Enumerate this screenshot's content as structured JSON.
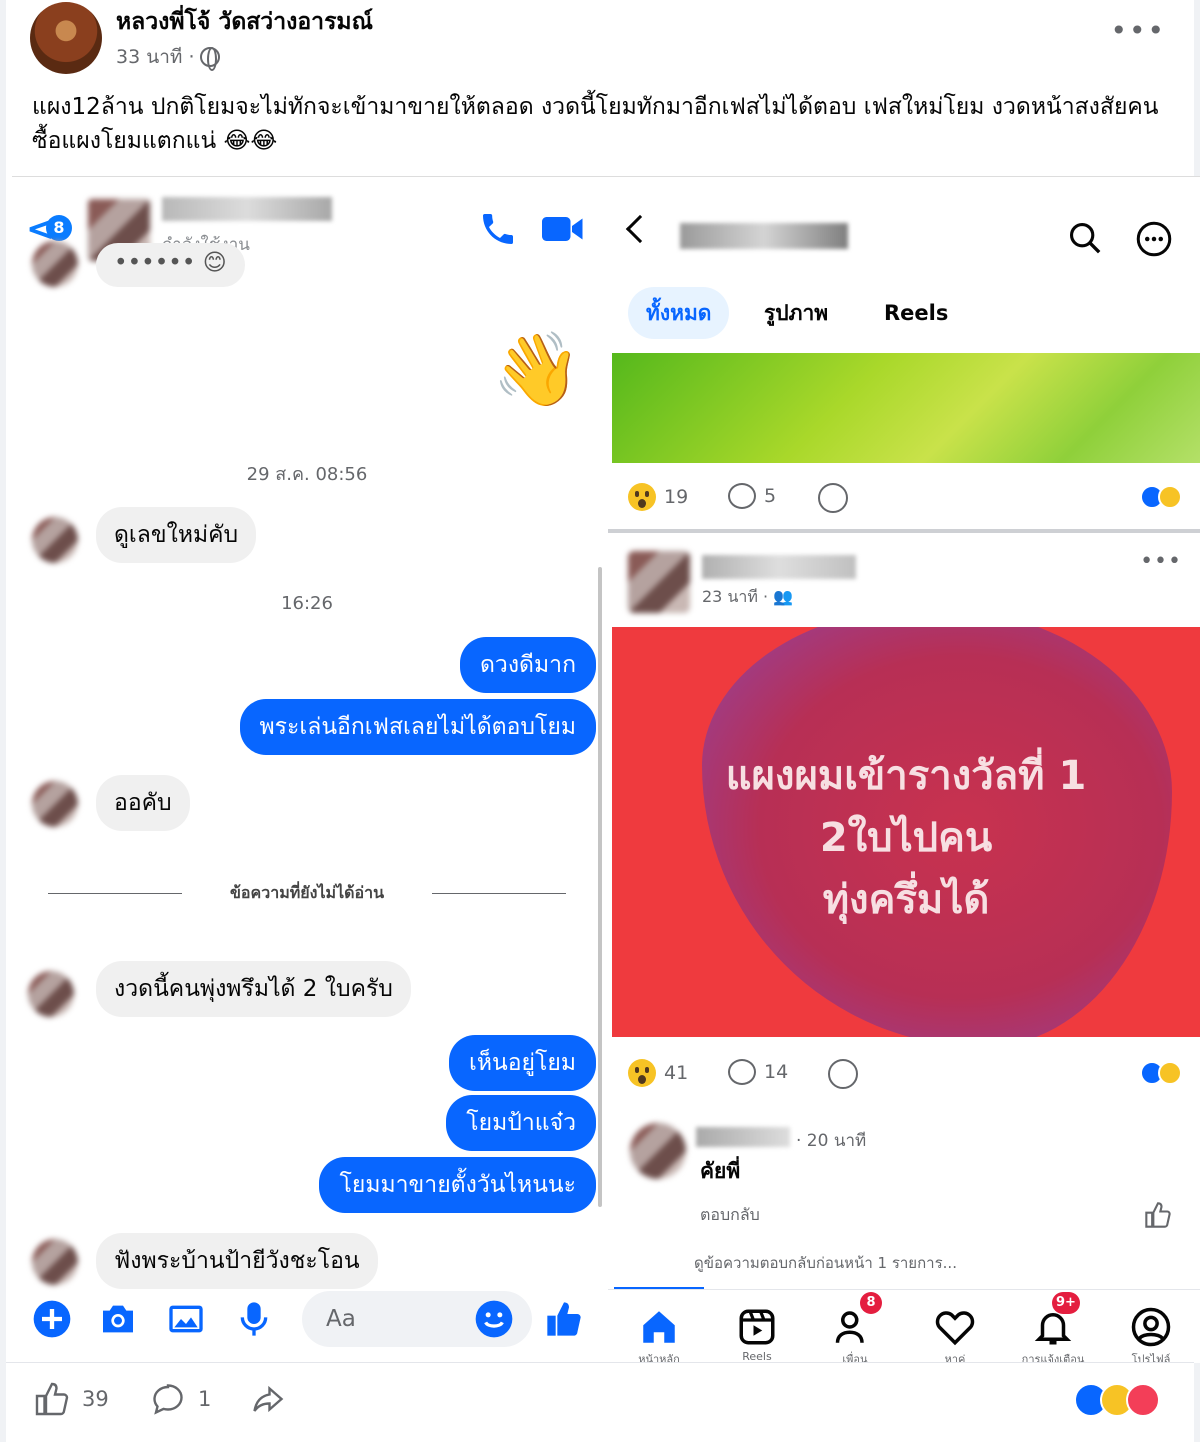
{
  "post": {
    "author": "หลวงพี่โจ้ วัดสว่างอารมณ์",
    "time": "33 นาที ·",
    "text": "แผง12ล้าน ปกติโยมจะไม่ทักจะเข้ามาขายให้ตลอด งวดนี้โยมทักมาอีกเฟสไม่ได้ตอบ เฟสใหม่โยม งวดหน้าสงสัยคนซื้อแผงโยมแตกแน่ 😂😂",
    "more_icon": "more-dots-icon"
  },
  "messenger": {
    "back_badge": "8",
    "status": "กำลังใช้งาน",
    "wave_emoji": "👋",
    "timestamp_1": "29 ส.ค. 08:56",
    "timestamp_2": "16:26",
    "unread_divider": "ข้อความที่ยังไม่ได้อ่าน",
    "messages": [
      {
        "dir": "in",
        "text": "ดูเลขใหม่คับ"
      },
      {
        "dir": "out",
        "text": "ดวงดีมาก"
      },
      {
        "dir": "out",
        "text": "พระเล่นอีกเฟสเลยไม่ได้ตอบโยม"
      },
      {
        "dir": "in",
        "text": "ออคับ"
      },
      {
        "dir": "in",
        "text": "งวดนี้คนพุ่งพรึมได้ 2 ใบครับ"
      },
      {
        "dir": "out",
        "text": "เห็นอยู่โยม"
      },
      {
        "dir": "out",
        "text": "โยมป้าแจ๋ว"
      },
      {
        "dir": "out",
        "text": "โยมมาขายตั้งวันไหนนะ"
      },
      {
        "dir": "in",
        "text": "ฟังพระบ้านป้ายีวังชะโอน"
      }
    ],
    "composer_placeholder": "Aa",
    "accent": "#0866ff"
  },
  "feed": {
    "tabs": [
      "ทั้งหมด",
      "รูปภาพ",
      "Reels"
    ],
    "post1": {
      "reactions": "19",
      "comments": "5"
    },
    "post2": {
      "time": "23 นาที ·",
      "image_text_line1": "แผงผมเข้ารางวัลที่ 1",
      "image_text_line2": "2ใบไปคน",
      "image_text_line3": "ทุ่งครึ่มได้",
      "reactions": "41",
      "comments": "14"
    },
    "comment": {
      "time": "· 20 นาที",
      "text": "คัยพี่",
      "reply": "ตอบกลับ",
      "more_replies": "ดูข้อความตอบกลับก่อนหน้า 1 รายการ..."
    },
    "nav": {
      "home": "หน้าหลัก",
      "reels": "Reels",
      "friends": "เพื่อน",
      "friends_badge": "8",
      "dating": "หาคู่",
      "notifications": "การแจ้งเตือน",
      "notifications_badge": "9+",
      "profile": "โปรไฟล์"
    }
  },
  "footer": {
    "likes": "39",
    "comments": "1"
  }
}
